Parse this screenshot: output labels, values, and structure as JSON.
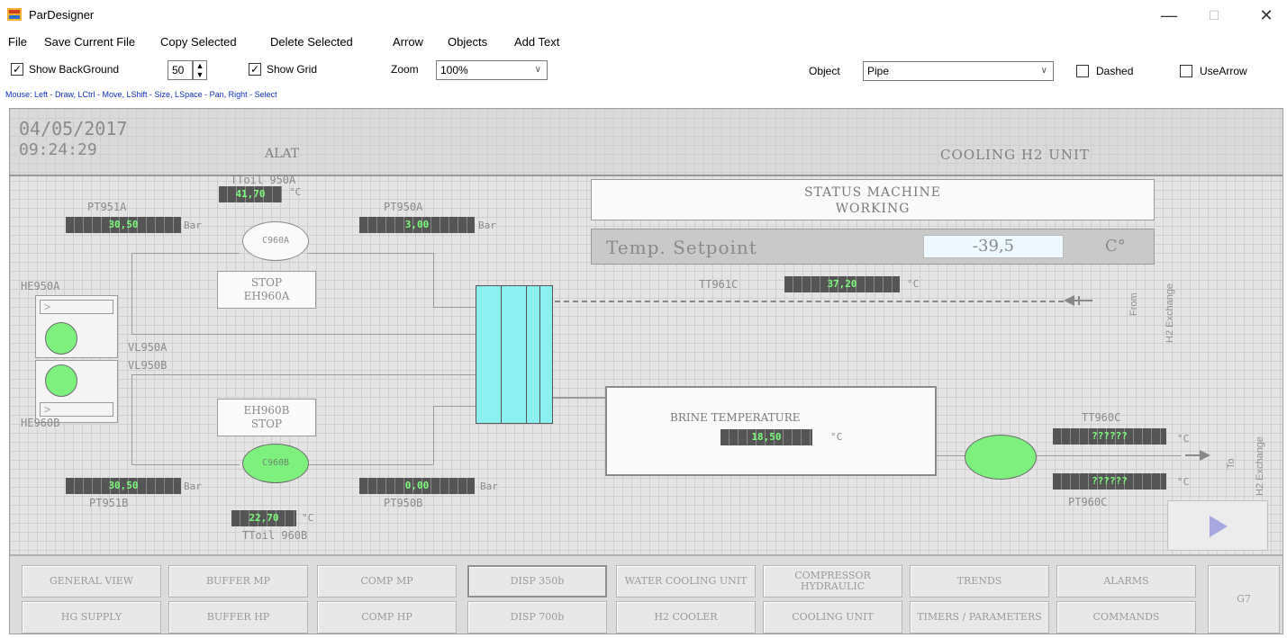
{
  "window": {
    "title": "ParDesigner",
    "minimize": "—",
    "maximize": "☐",
    "close": "✕"
  },
  "menu": [
    "File",
    "Save Current File",
    "Copy Selected",
    "Delete Selected",
    "Arrow",
    "Objects",
    "Add Text"
  ],
  "toolbar": {
    "show_background_label": "Show BackGround",
    "background_value": "50",
    "show_grid_label": "Show Grid",
    "zoom_label": "Zoom",
    "zoom_value": "100%",
    "object_label": "Object",
    "object_value": "Pipe",
    "dashed_label": "Dashed",
    "usearrow_label": "UseArrow",
    "hint": "Mouse: Left - Draw, LCtrl - Move, LShift - Size, LSpace - Pan, Right - Select"
  },
  "header": {
    "date": "04/05/2017",
    "time": "09:24:29",
    "alarm": "ALAT",
    "unit_title": "COOLING H2 UNIT"
  },
  "status": {
    "line1": "STATUS MACHINE",
    "line2": "WORKING",
    "setpoint_label": "Temp. Setpoint",
    "setpoint_value": "-39,5",
    "setpoint_unit": "C°"
  },
  "labels": {
    "ttoil950a": "TToil 950A",
    "pt951a": "PT951A",
    "pt950a": "PT950A",
    "bar": "Bar",
    "degc": "°C",
    "he950a": "HE950A",
    "vl950a": "VL950A",
    "vl950b": "VL950B",
    "he960b": "HE960B",
    "pt951b": "PT951B",
    "pt950b": "PT950B",
    "ttoil960b": "TToil 960B",
    "tt961c": "TT961C",
    "tt960c": "TT960C",
    "pt960c": "PT960C",
    "c960a": "C960A",
    "c960b": "C960B",
    "stop_a_1": "STOP",
    "stop_a_2": "EH960A",
    "stop_b_1": "EH960B",
    "stop_b_2": "STOP",
    "brine": "BRINE TEMPERATURE",
    "from_1": "From",
    "from_2": "H2 Exchange",
    "to_1": "To",
    "to_2": "H2 Exchange"
  },
  "values": {
    "ttoil950a": "41,70",
    "pt951a": "30,50",
    "pt950a": "3,00",
    "pt951b": "30,50",
    "pt950b": "0,00",
    "ttoil960b": "22,70",
    "tt961c": "37,20",
    "brine": "18,50",
    "tt960c": "??????",
    "pt960c": "??????"
  },
  "nav": [
    {
      "label": "GENERAL VIEW"
    },
    {
      "label": "BUFFER MP"
    },
    {
      "label": "COMP MP"
    },
    {
      "label": "DISP 350b"
    },
    {
      "label": "WATER COOLING UNIT"
    },
    {
      "label": "COMPRESSOR HYDRAULIC"
    },
    {
      "label": "TRENDS"
    },
    {
      "label": "ALARMS"
    },
    {
      "label": "HG SUPPLY"
    },
    {
      "label": "BUFFER HP"
    },
    {
      "label": "COMP HP"
    },
    {
      "label": "DISP 700b"
    },
    {
      "label": "H2 COOLER"
    },
    {
      "label": "COOLING UNIT"
    },
    {
      "label": "TIMERS / PARAMETERS"
    },
    {
      "label": "COMMANDS"
    },
    {
      "label": "G7"
    }
  ],
  "colors": {
    "value_text": "#7cfc7c",
    "pump": "#7ef07e",
    "exchanger": "#8cf0f0",
    "hint": "#1030c0"
  }
}
